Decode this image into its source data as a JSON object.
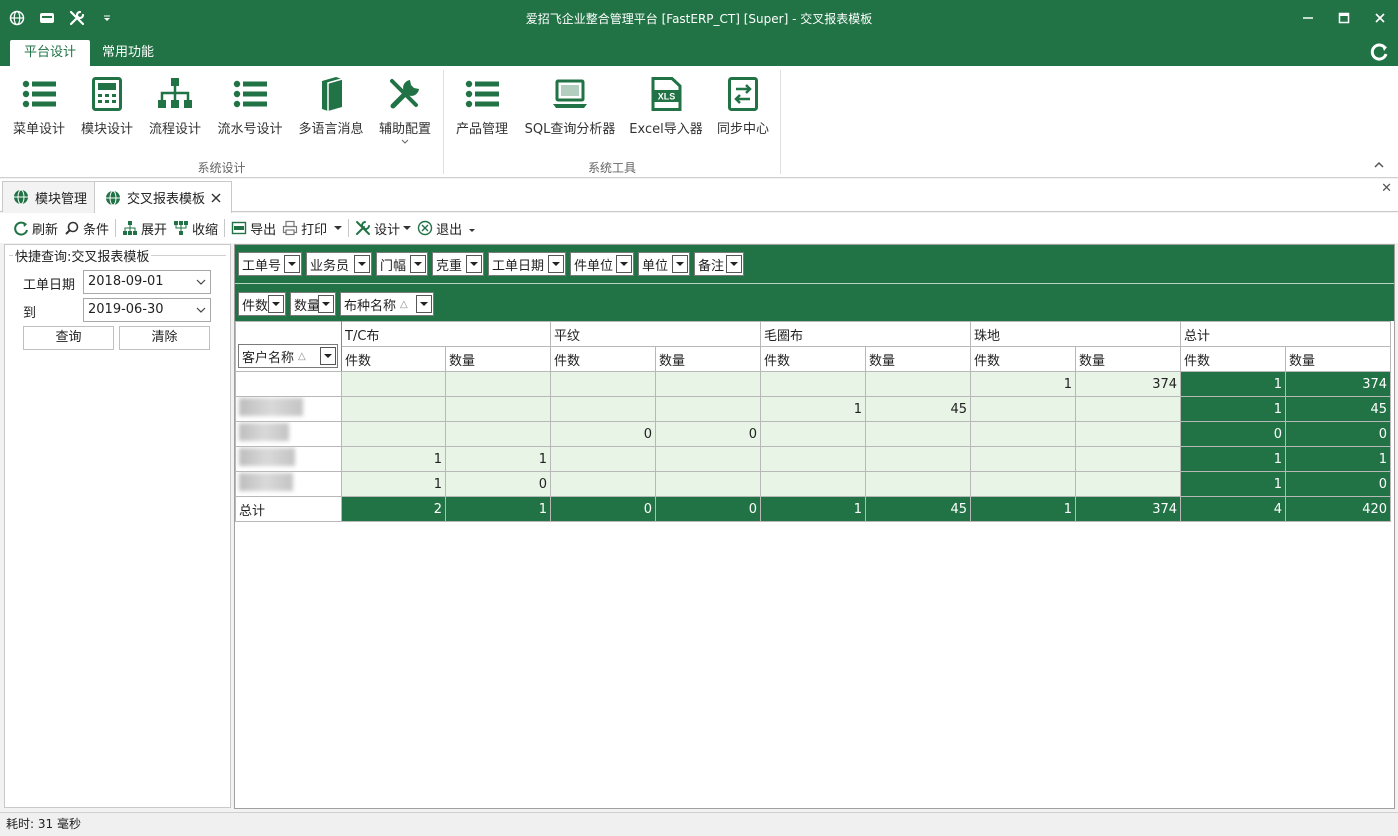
{
  "window": {
    "title": "爱招飞企业整合管理平台 [FastERP_CT] [Super] - 交叉报表模板"
  },
  "ribbon": {
    "tabs": [
      {
        "label": "平台设计",
        "active": true
      },
      {
        "label": "常用功能",
        "active": false
      }
    ],
    "groups": [
      {
        "label": "系统设计",
        "buttons": [
          {
            "label": "菜单设计",
            "icon": "list-icon"
          },
          {
            "label": "模块设计",
            "icon": "calculator-icon"
          },
          {
            "label": "流程设计",
            "icon": "org-chart-icon"
          },
          {
            "label": "流水号设计",
            "icon": "list-icon"
          },
          {
            "label": "多语言消息",
            "icon": "book-icon"
          },
          {
            "label": "辅助配置",
            "icon": "tools-icon"
          }
        ]
      },
      {
        "label": "系统工具",
        "buttons": [
          {
            "label": "产品管理",
            "icon": "list-icon"
          },
          {
            "label": "SQL查询分析器",
            "icon": "laptop-icon"
          },
          {
            "label": "Excel导入器",
            "icon": "xls-icon"
          },
          {
            "label": "同步中心",
            "icon": "sync-icon"
          }
        ]
      }
    ],
    "xls_badge": "XLS"
  },
  "doc_tabs": [
    {
      "label": "模块管理",
      "active": false
    },
    {
      "label": "交叉报表模板",
      "active": true
    }
  ],
  "toolbar": {
    "refresh": "刷新",
    "condition": "条件",
    "expand": "展开",
    "collapse": "收缩",
    "export": "导出",
    "print": "打印",
    "design": "设计",
    "exit": "退出"
  },
  "quick_query": {
    "title": "快捷查询:交叉报表模板",
    "date_label": "工单日期",
    "to_label": "到",
    "date_from": "2018-09-01",
    "date_to": "2019-06-30",
    "query_button": "查询",
    "clear_button": "清除"
  },
  "pivot": {
    "filter_fields": [
      "工单号",
      "业务员",
      "门幅",
      "克重",
      "工单日期",
      "件单位",
      "单位",
      "备注"
    ],
    "data_fields": [
      "件数",
      "数量"
    ],
    "column_field": "布种名称",
    "row_field": "客户名称",
    "column_groups": [
      "T/C布",
      "平纹",
      "毛圈布",
      "珠地",
      "总计"
    ],
    "measure_labels": [
      "件数",
      "数量"
    ],
    "rows": [
      {
        "label": "",
        "cells": [
          "",
          "",
          "",
          "",
          "",
          "",
          "1",
          "374",
          "1",
          "374"
        ]
      },
      {
        "label": "",
        "cells": [
          "",
          "",
          "",
          "",
          "1",
          "45",
          "",
          "",
          "1",
          "45"
        ]
      },
      {
        "label": "",
        "cells": [
          "",
          "",
          "0",
          "0",
          "",
          "",
          "",
          "",
          "0",
          "0"
        ]
      },
      {
        "label": "",
        "cells": [
          "1",
          "1",
          "",
          "",
          "",
          "",
          "",
          "",
          "1",
          "1"
        ]
      },
      {
        "label": "",
        "cells": [
          "1",
          "0",
          "",
          "",
          "",
          "",
          "",
          "",
          "1",
          "0"
        ]
      }
    ],
    "total_row": {
      "label": "总计",
      "cells": [
        "2",
        "1",
        "0",
        "0",
        "1",
        "45",
        "1",
        "374",
        "4",
        "420"
      ]
    }
  },
  "status": {
    "elapsed": "耗时: 31 毫秒"
  },
  "colors": {
    "accent": "#217346",
    "cell_fill": "#e8f4e6"
  }
}
